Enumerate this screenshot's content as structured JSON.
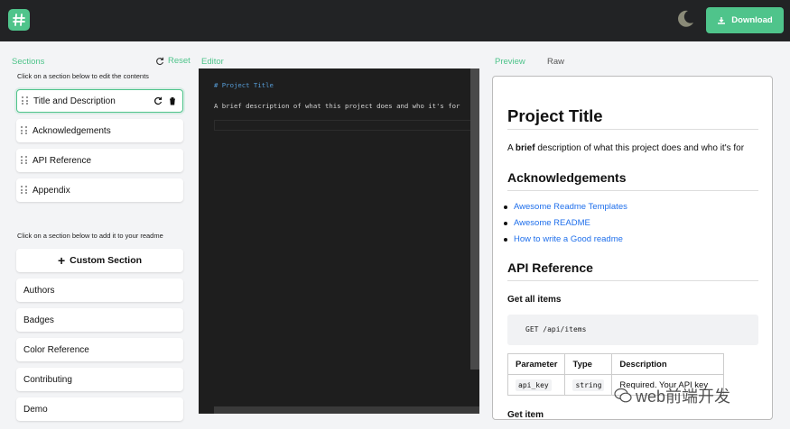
{
  "header": {
    "download_label": "Download",
    "logo_icon": "hash-logo-icon",
    "theme_icon": "moon-icon",
    "accent_color": "#4fc48b"
  },
  "sections_panel": {
    "title": "Sections",
    "reset_label": "Reset",
    "edit_hint": "Click on a section below to edit the contents",
    "current_sections": [
      "Title and Description",
      "Acknowledgements",
      "API Reference",
      "Appendix"
    ],
    "add_hint": "Click on a section below to add it to your readme",
    "custom_section_label": "Custom Section",
    "available_sections": [
      "Authors",
      "Badges",
      "Color Reference",
      "Contributing",
      "Demo"
    ]
  },
  "editor": {
    "title": "Editor",
    "lines": [
      "# Project Title",
      "A brief description of what this project does and who it's for"
    ]
  },
  "preview": {
    "tab_preview": "Preview",
    "tab_raw": "Raw",
    "h1": "Project Title",
    "description_pre": "A ",
    "description_bold": "brief",
    "description_post": " description of what this project does and who it's for",
    "ack_heading": "Acknowledgements",
    "links": [
      "Awesome Readme Templates",
      "Awesome README",
      "How to write a Good readme"
    ],
    "api_heading": "API Reference",
    "get_all": "Get all items",
    "code": "GET /api/items",
    "table_headers": [
      "Parameter",
      "Type",
      "Description"
    ],
    "table_row": [
      "api_key",
      "string",
      "Required. Your API key"
    ],
    "get_item": "Get item"
  },
  "watermark": "web前端开发"
}
